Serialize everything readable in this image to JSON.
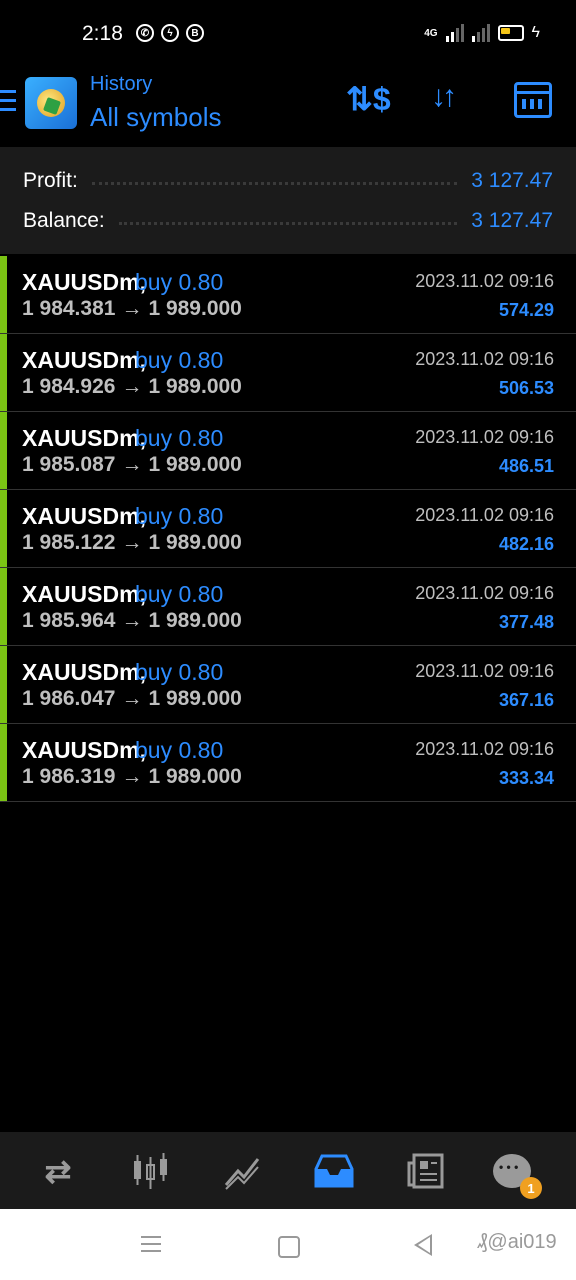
{
  "status_bar": {
    "time": "2:18",
    "left_icons": [
      "whatsapp-icon",
      "messenger-icon",
      "b-icon"
    ],
    "network": "4G",
    "battery": "charging"
  },
  "header": {
    "subtitle": "History",
    "title": "All symbols",
    "actions": [
      "currency-exchange-icon",
      "sort-icon",
      "calendar-icon"
    ]
  },
  "summary": {
    "profit_label": "Profit:",
    "profit_value": "3 127.47",
    "balance_label": "Balance:",
    "balance_value": "3 127.47"
  },
  "deals": [
    {
      "symbol": "XAUUSDm,",
      "type": "buy 0.80",
      "open": "1 984.381",
      "arrow": "→",
      "close": "1 989.000",
      "time": "2023.11.02 09:16",
      "profit": "574.29"
    },
    {
      "symbol": "XAUUSDm,",
      "type": "buy 0.80",
      "open": "1 984.926",
      "arrow": "→",
      "close": "1 989.000",
      "time": "2023.11.02 09:16",
      "profit": "506.53"
    },
    {
      "symbol": "XAUUSDm,",
      "type": "buy 0.80",
      "open": "1 985.087",
      "arrow": "→",
      "close": "1 989.000",
      "time": "2023.11.02 09:16",
      "profit": "486.51"
    },
    {
      "symbol": "XAUUSDm,",
      "type": "buy 0.80",
      "open": "1 985.122",
      "arrow": "→",
      "close": "1 989.000",
      "time": "2023.11.02 09:16",
      "profit": "482.16"
    },
    {
      "symbol": "XAUUSDm,",
      "type": "buy 0.80",
      "open": "1 985.964",
      "arrow": "→",
      "close": "1 989.000",
      "time": "2023.11.02 09:16",
      "profit": "377.48"
    },
    {
      "symbol": "XAUUSDm,",
      "type": "buy 0.80",
      "open": "1 986.047",
      "arrow": "→",
      "close": "1 989.000",
      "time": "2023.11.02 09:16",
      "profit": "367.16"
    },
    {
      "symbol": "XAUUSDm,",
      "type": "buy 0.80",
      "open": "1 986.319",
      "arrow": "→",
      "close": "1 989.000",
      "time": "2023.11.02 09:16",
      "profit": "333.34"
    }
  ],
  "tabbar": {
    "tabs": [
      "quotes-icon",
      "chart-icon",
      "trade-icon",
      "history-icon",
      "news-icon",
      "chat-icon"
    ],
    "active": "history-icon",
    "chat_badge": "1"
  },
  "watermark": "₰@ai019",
  "colors": {
    "accent": "#2d8cff",
    "buy_bar": "#7bc314",
    "summary_bg": "#1b1b1b",
    "badge": "#f0a020"
  }
}
